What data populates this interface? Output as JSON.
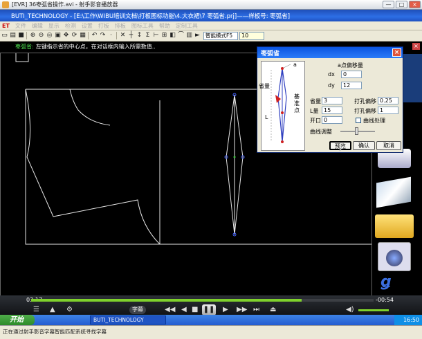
{
  "window": {
    "title": "[EVR] 36枣弧省操作.avi - 射手影音播放器",
    "app_title": "BUTI_TECHNOLOGY - [E:\\工作\\WIBU培训文档\\打板图标功能\\4.大衣裙\\7 枣弧省.prj]——样板号: 枣弧省]",
    "controls": [
      "—",
      "□",
      "×"
    ]
  },
  "menu": {
    "logo": "ET",
    "items": [
      "文件",
      "编辑",
      "显示",
      "检测",
      "设置",
      "打板",
      "排板",
      "图标工具",
      "帮助",
      "定制工具"
    ]
  },
  "toolbar": {
    "mode_label": "智能模式F5",
    "zoom_value": "10"
  },
  "status": {
    "label": "枣弧省:",
    "message": "左键指示省的中心点，在对话框内输入所需数值.."
  },
  "dialog": {
    "title": "枣弧省",
    "diagram_label_top": "a",
    "diagram_label_left": "省量",
    "diagram_label_right": "基准点",
    "diagram_label_L": "L",
    "offset_group": "a点偏移量",
    "dx_label": "dx",
    "dx_value": "0",
    "dy_label": "dy",
    "dy_value": "12",
    "amount_label": "省量",
    "amount_value": "3",
    "length_label": "L量",
    "length_value": "15",
    "opening_label": "开口",
    "opening_value": "0",
    "punch1_label": "打孔偏移",
    "punch1_value": "0.25",
    "punch2_label": "打孔偏移",
    "punch2_value": "1",
    "curve_label": "曲线处理",
    "curve_adjust_label": "曲线调整",
    "preview_button": "预览",
    "ok_button": "确认",
    "cancel_button": "取消"
  },
  "player": {
    "time_elapsed": "03:17",
    "time_remaining": "-00:54",
    "subtitle_button": "字幕",
    "progress_fraction": 0.79
  },
  "taskbar": {
    "start_label": "开始",
    "task_label": "BUTI_TECHNOLOGY",
    "clock": "16:50"
  },
  "bottom_bar": {
    "message": "正在通过射手影音字幕智能匹配系统寻找字幕"
  }
}
